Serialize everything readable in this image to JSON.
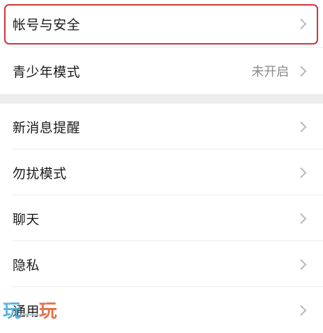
{
  "groups": [
    {
      "items": [
        {
          "label": "帐号与安全",
          "value": "",
          "highlighted": true
        },
        {
          "label": "青少年模式",
          "value": "未开启",
          "highlighted": false
        }
      ]
    },
    {
      "items": [
        {
          "label": "新消息提醒",
          "value": ""
        },
        {
          "label": "勿扰模式",
          "value": ""
        },
        {
          "label": "聊天",
          "value": ""
        },
        {
          "label": "隐私",
          "value": ""
        },
        {
          "label": "通用",
          "value": ""
        }
      ]
    }
  ],
  "watermark": {
    "left": "玩",
    "right": "玩"
  },
  "colors": {
    "highlight_border": "#d13238",
    "section_gap": "#ededed",
    "chevron": "#b8b8b8",
    "secondary_text": "#8a8a8a"
  },
  "icons": {
    "row_chevron": "chevron-right-icon"
  }
}
